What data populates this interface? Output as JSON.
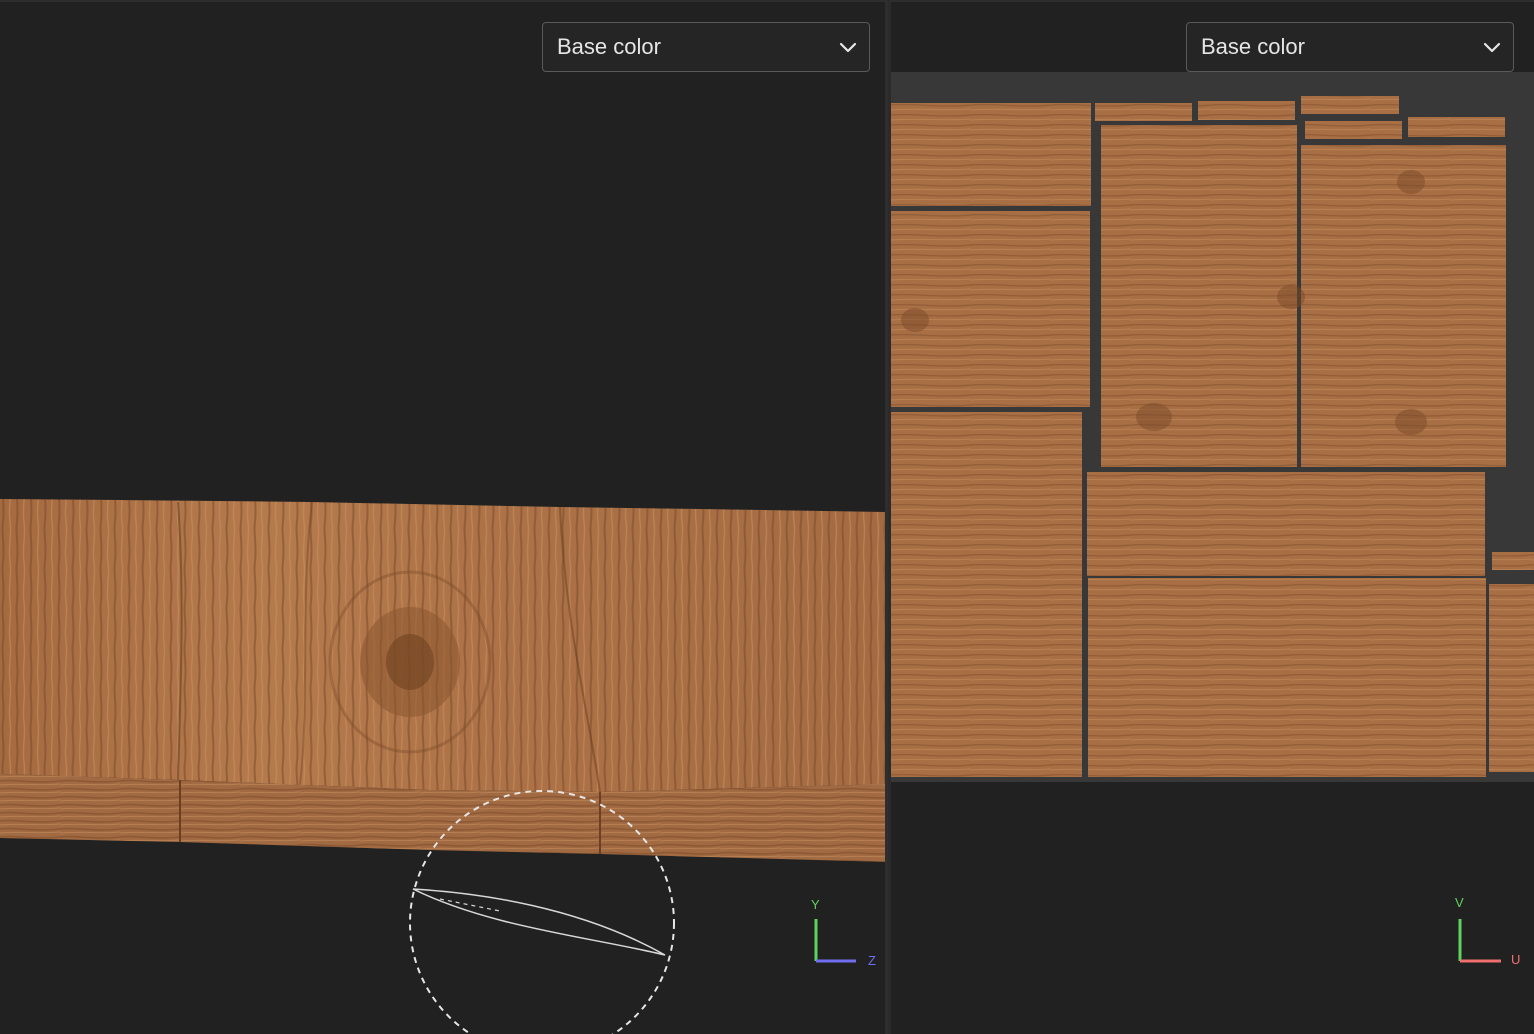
{
  "viewports": {
    "model_3d": {
      "channel_select": {
        "value": "Base color"
      },
      "axes": {
        "up": "Y",
        "right": "Z"
      }
    },
    "uv": {
      "channel_select": {
        "value": "Base color"
      },
      "axes": {
        "up": "V",
        "right": "U"
      }
    }
  },
  "colors": {
    "viewport_bg": "#212121",
    "uv_canvas_bg": "#383838",
    "wood": "#a86f45",
    "axis_y": "#5fd35f",
    "axis_z": "#6f6ff0",
    "axis_u": "#ef6f6f"
  },
  "icons": {
    "dropdown": "chevron-down-icon",
    "gizmo": "dashed-circle-gizmo"
  }
}
